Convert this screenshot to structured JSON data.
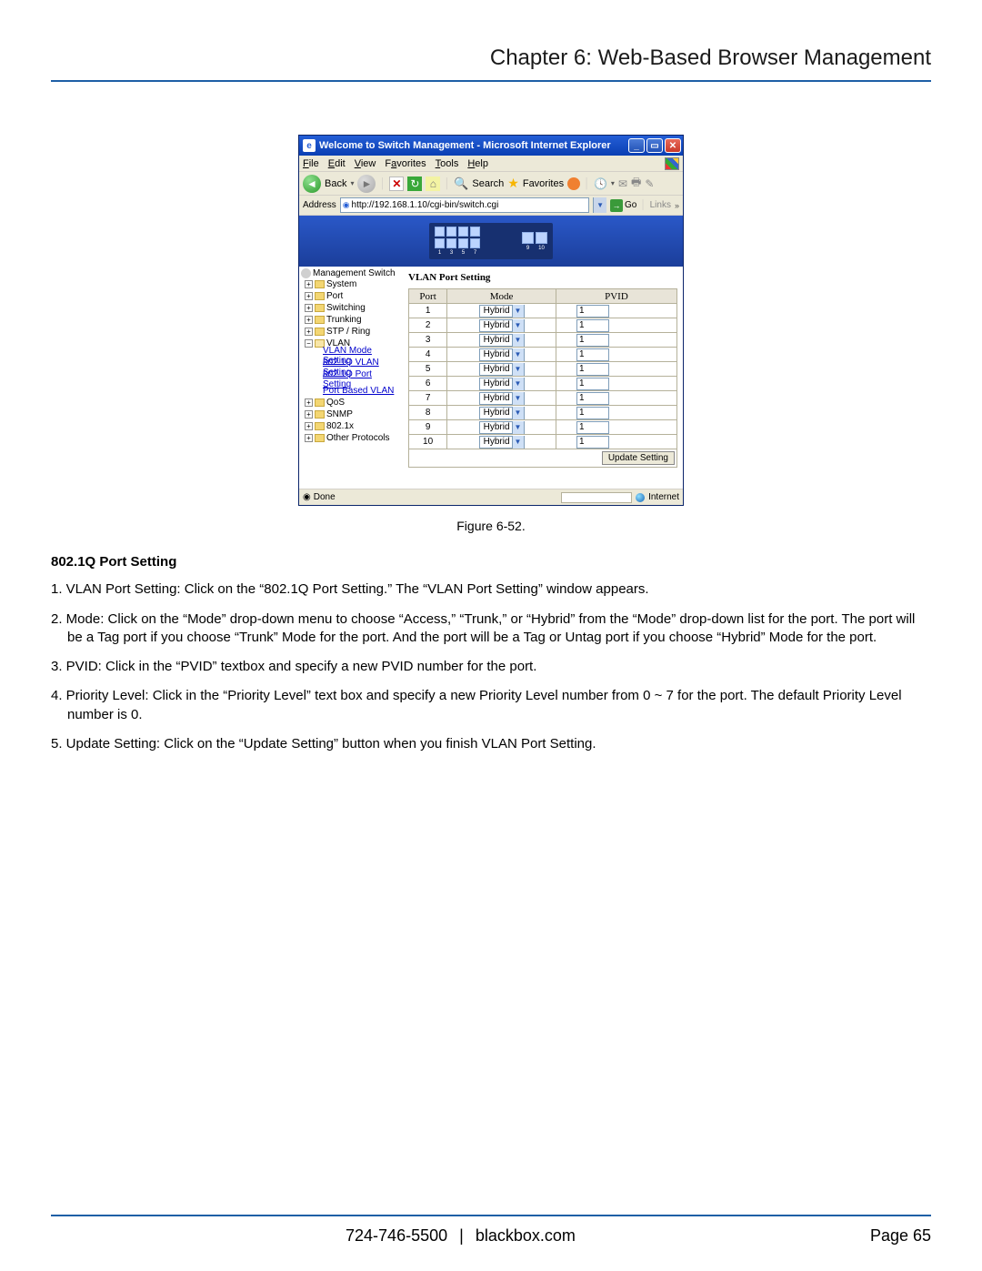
{
  "chapter_title": "Chapter 6: Web-Based Browser Management",
  "ie_window": {
    "title": "Welcome to Switch Management - Microsoft Internet Explorer",
    "menubar": [
      "File",
      "Edit",
      "View",
      "Favorites",
      "Tools",
      "Help"
    ],
    "toolbar": {
      "back": "Back",
      "search": "Search",
      "favorites": "Favorites"
    },
    "address_label": "Address",
    "address_url": "http://192.168.1.10/cgi-bin/switch.cgi",
    "go": "Go",
    "links": "Links",
    "switch_ports_main": 8,
    "switch_ports_uplink": 2,
    "tree": {
      "root": "Management Switch",
      "items": [
        {
          "label": "System",
          "state": "plus"
        },
        {
          "label": "Port",
          "state": "plus"
        },
        {
          "label": "Switching",
          "state": "plus"
        },
        {
          "label": "Trunking",
          "state": "plus"
        },
        {
          "label": "STP / Ring",
          "state": "plus"
        },
        {
          "label": "VLAN",
          "state": "minus",
          "children": [
            "VLAN Mode Setting",
            "802.1Q VLAN Setting",
            "802.1Q Port Setting",
            "Port Based VLAN"
          ]
        },
        {
          "label": "QoS",
          "state": "plus"
        },
        {
          "label": "SNMP",
          "state": "plus"
        },
        {
          "label": "802.1x",
          "state": "plus"
        },
        {
          "label": "Other Protocols",
          "state": "plus"
        }
      ]
    },
    "panel_title": "VLAN Port Setting",
    "table": {
      "headers": [
        "Port",
        "Mode",
        "PVID"
      ],
      "rows": [
        {
          "port": "1",
          "mode": "Hybrid",
          "pvid": "1"
        },
        {
          "port": "2",
          "mode": "Hybrid",
          "pvid": "1"
        },
        {
          "port": "3",
          "mode": "Hybrid",
          "pvid": "1"
        },
        {
          "port": "4",
          "mode": "Hybrid",
          "pvid": "1"
        },
        {
          "port": "5",
          "mode": "Hybrid",
          "pvid": "1"
        },
        {
          "port": "6",
          "mode": "Hybrid",
          "pvid": "1"
        },
        {
          "port": "7",
          "mode": "Hybrid",
          "pvid": "1"
        },
        {
          "port": "8",
          "mode": "Hybrid",
          "pvid": "1"
        },
        {
          "port": "9",
          "mode": "Hybrid",
          "pvid": "1"
        },
        {
          "port": "10",
          "mode": "Hybrid",
          "pvid": "1"
        }
      ],
      "update_button": "Update Setting"
    },
    "status_left": "Done",
    "status_right": "Internet"
  },
  "figure_caption": "Figure 6-52.",
  "section_heading": "802.1Q Port Setting",
  "steps": [
    "1. VLAN Port Setting: Click on the “802.1Q Port Setting.” The “VLAN Port Setting” window appears.",
    "2. Mode: Click on the “Mode” drop-down menu to choose “Access,” “Trunk,” or “Hybrid” from the “Mode” drop-down list for the port. The port will be a Tag port if you choose “Trunk” Mode for the port. And the port will be a Tag or Untag port if you choose “Hybrid” Mode for the port.",
    "3. PVID: Click in the “PVID” textbox and specify a new PVID number for the port.",
    "4. Priority Level: Click in the “Priority Level” text box and specify a new Priority Level number from 0 ~ 7 for the port. The default Priority Level number is 0.",
    "5. Update Setting: Click on the “Update Setting” button when you finish VLAN Port Setting."
  ],
  "footer": {
    "phone": "724-746-5500",
    "site": "blackbox.com",
    "page": "Page 65"
  }
}
